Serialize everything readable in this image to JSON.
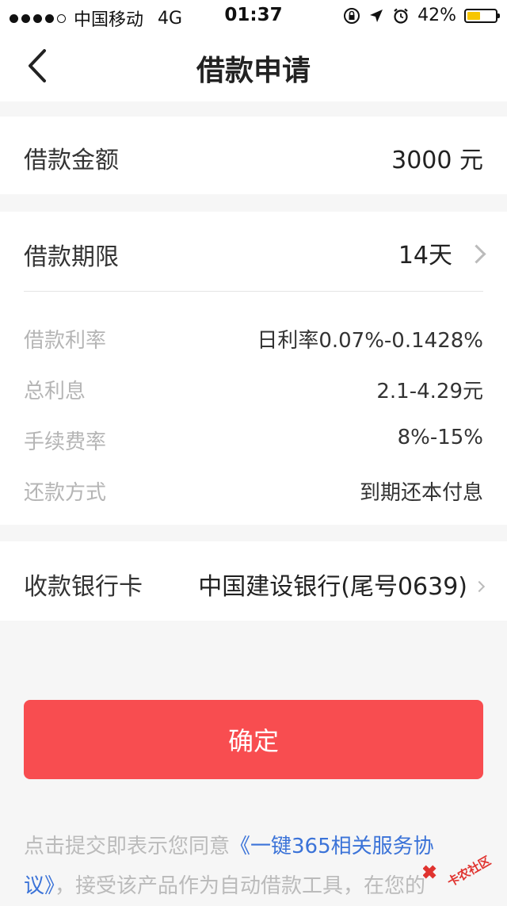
{
  "status_bar": {
    "carrier": "中国移动",
    "network": "4G",
    "time": "01:37",
    "battery": "42%",
    "battery_level": 0.42
  },
  "nav": {
    "title": "借款申请"
  },
  "amount": {
    "label": "借款金额",
    "value": "3000 元"
  },
  "term": {
    "label": "借款期限",
    "value": "14天"
  },
  "details": [
    {
      "label": "借款利率",
      "value": "日利率0.07%-0.1428%"
    },
    {
      "label": "总利息",
      "value": "2.1-4.29元"
    },
    {
      "label": "手续费率",
      "value": "8%-15%"
    },
    {
      "label": "还款方式",
      "value": "到期还本付息"
    }
  ],
  "bank_card": {
    "label": "收款银行卡",
    "value": "中国建设银行(尾号0639)"
  },
  "confirm_button": "确定",
  "agreement": {
    "prefix": "点击提交即表示您同意",
    "link": "《一键365相关服务协议》",
    "suffix": "，接受该产品作为自动借款工具，在您的"
  },
  "watermark": "卡农社区"
}
